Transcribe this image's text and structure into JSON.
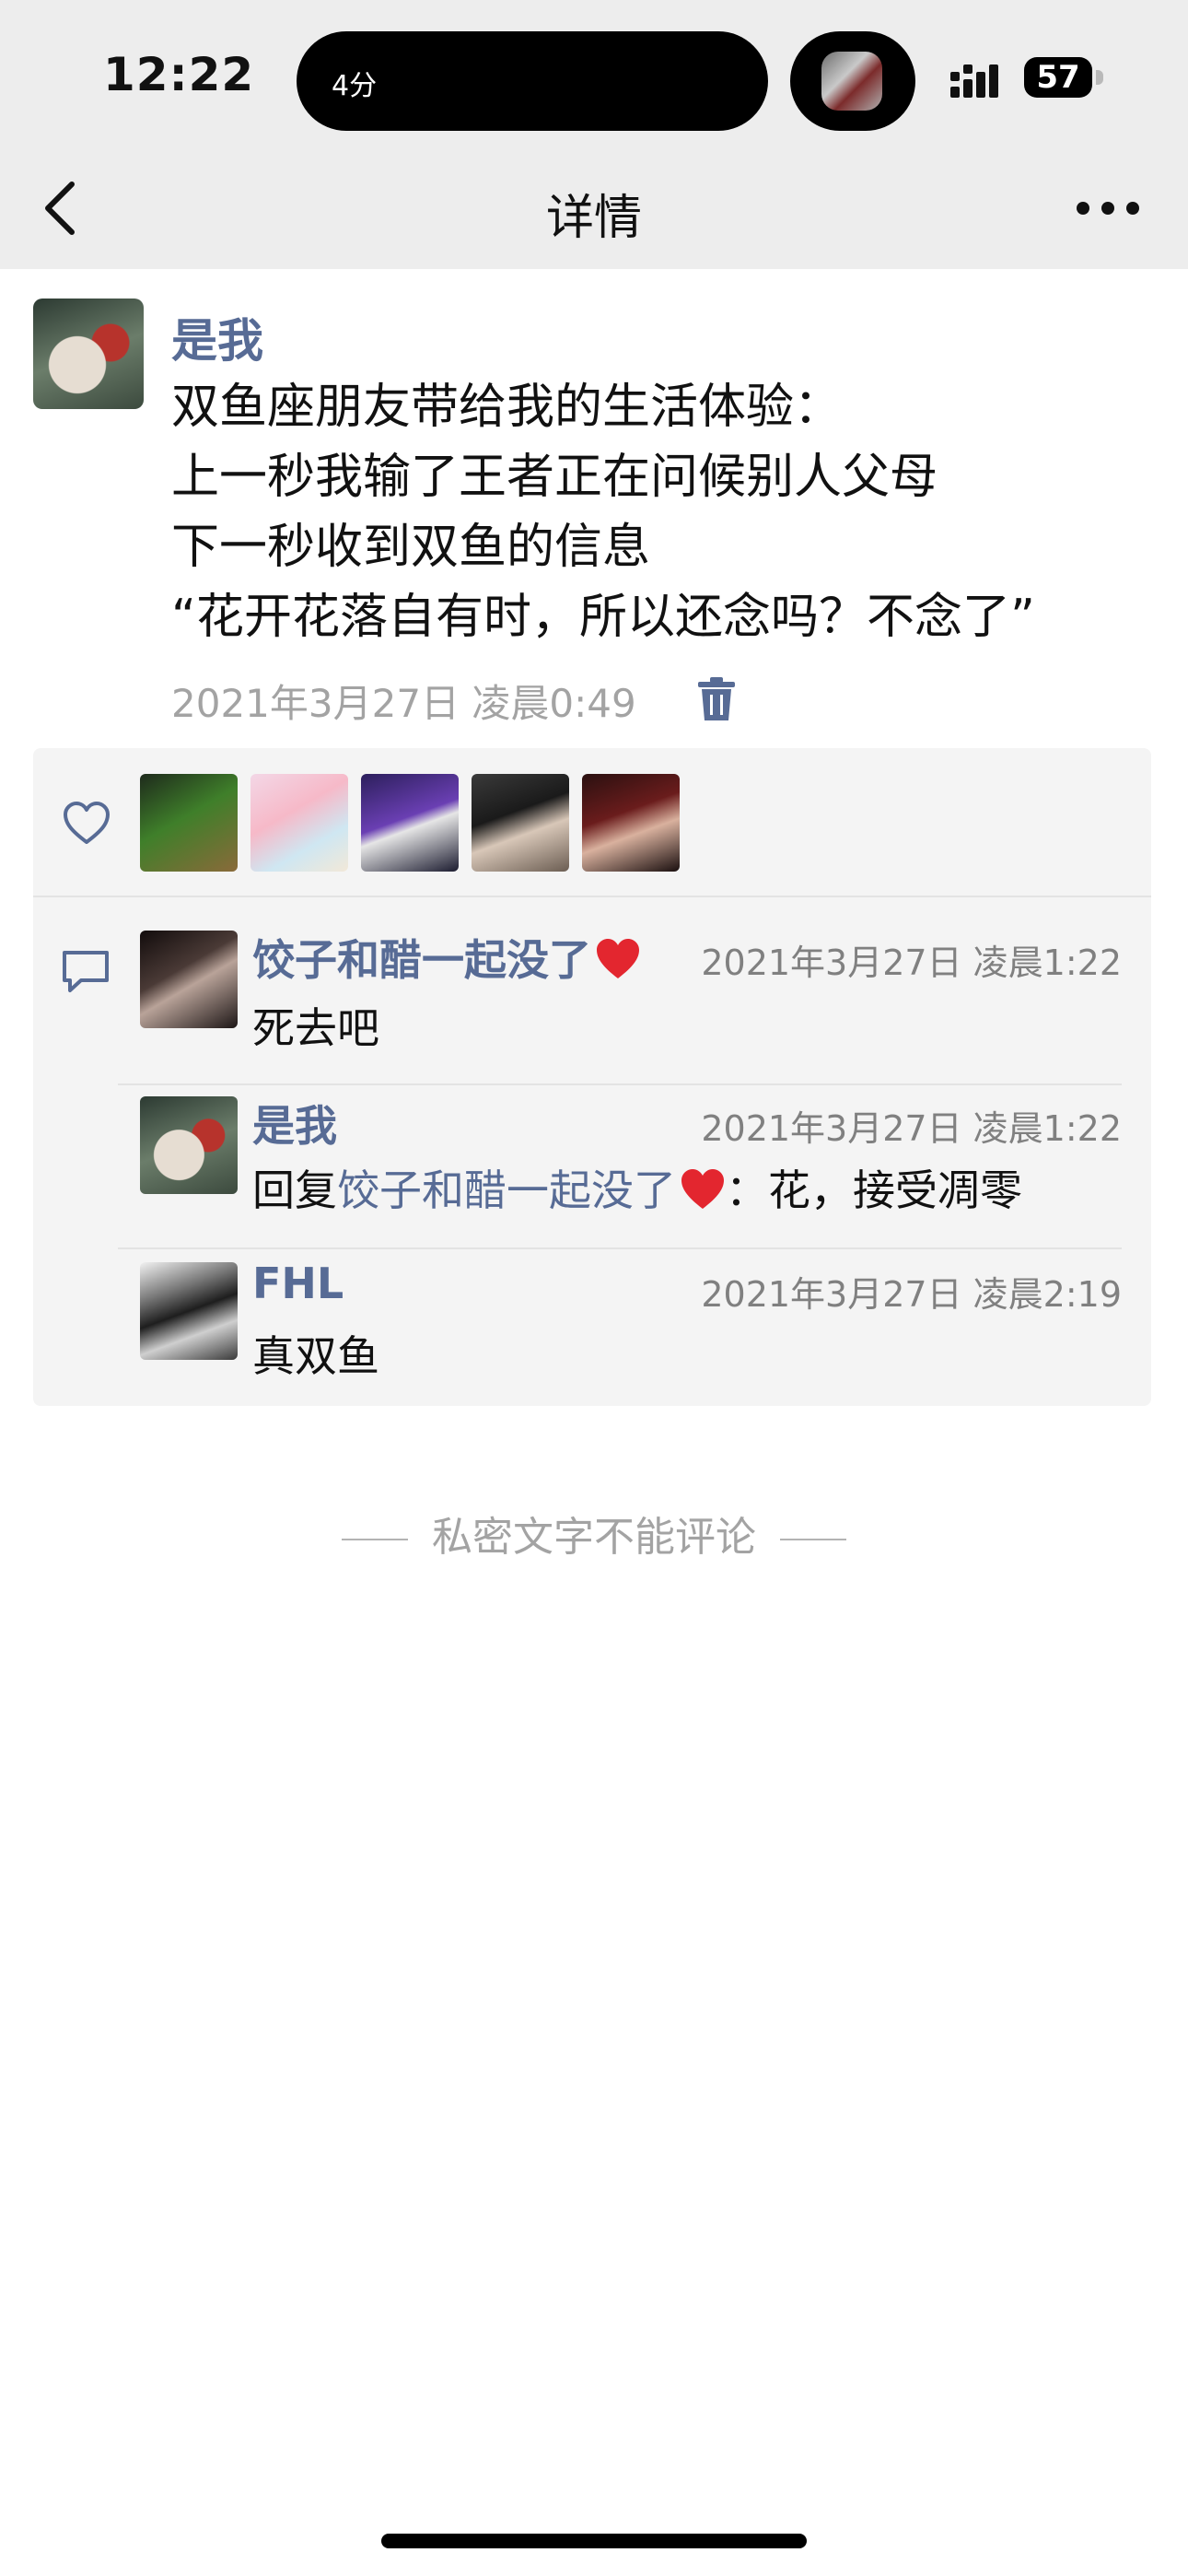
{
  "status_bar": {
    "time": "12:22",
    "island_text": "4分",
    "battery": "57"
  },
  "nav": {
    "title": "详情"
  },
  "post": {
    "author": "是我",
    "lines": [
      "双鱼座朋友带给我的生活体验：",
      "上一秒我输了王者正在问候别人父母",
      "下一秒收到双鱼的信息",
      "“花开花落自有时，所以还念吗？不念了”"
    ],
    "timestamp": "2021年3月27日 凌晨0:49"
  },
  "likes": {
    "count": 5
  },
  "comments": [
    {
      "author": "饺子和醋一起没了",
      "time": "2021年3月27日 凌晨1:22",
      "text": "死去吧"
    },
    {
      "author": "是我",
      "time": "2021年3月27日 凌晨1:22",
      "reply_prefix": "回复",
      "reply_to": "饺子和醋一起没了",
      "text": "：花，接受凋零"
    },
    {
      "author": "FHL",
      "time": "2021年3月27日 凌晨2:19",
      "text": "真双鱼"
    }
  ],
  "footer": {
    "text": "私密文字不能评论"
  },
  "colors": {
    "link": "#576b95",
    "meta": "#a3a3a3",
    "bg_top": "#ededed",
    "comment_bg": "#f4f4f4"
  },
  "icons": [
    "back-chevron-icon",
    "more-dots-icon",
    "trash-icon",
    "heart-outline-icon",
    "comment-bubble-icon",
    "red-heart-emoji"
  ]
}
